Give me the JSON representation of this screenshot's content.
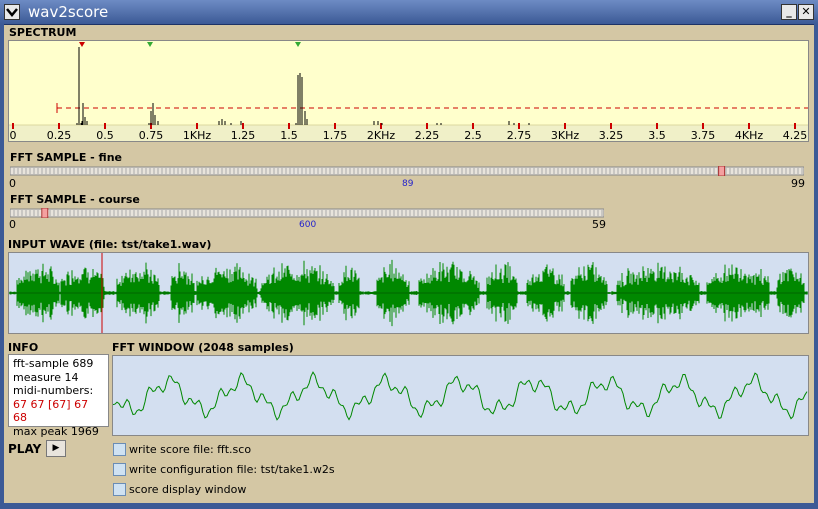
{
  "window": {
    "title": "wav2score",
    "minimize": "_",
    "maximize": "□",
    "close": "✕"
  },
  "spectrum": {
    "label": "SPECTRUM",
    "axis_labels": [
      "0",
      "0.25",
      "0.5",
      "0.75",
      "1KHz",
      "1.25",
      "1.5",
      "1.75",
      "2KHz",
      "2.25",
      "2.5",
      "2.75",
      "3KHz",
      "3.25",
      "3.5",
      "3.75",
      "4KHz",
      "4.25"
    ],
    "colors": {
      "background": "#ffffcc",
      "threshold": "#cc0000",
      "marker_red": "#cc0000",
      "marker_green": "#33aa33"
    }
  },
  "fft_fine": {
    "label": "FFT SAMPLE - fine",
    "min": "0",
    "max": "99",
    "value": "89",
    "value_num": 89,
    "range_max": 99
  },
  "fft_course": {
    "label": "FFT SAMPLE - course",
    "min": "0",
    "max": "59",
    "value": "600",
    "value_num": 3,
    "range_max": 59
  },
  "input_wave": {
    "label": "INPUT WAVE (file: tst/take1.wav)",
    "colors": {
      "wave": "#008800",
      "cursor": "#cc0000",
      "background": "#d3dff0"
    }
  },
  "info": {
    "label": "INFO",
    "lines": [
      "fft-sample 689",
      "measure 14",
      "midi-numbers:"
    ],
    "midi": "67 67 [67] 67 68",
    "peak": "max peak 1969"
  },
  "fft_window": {
    "label": "FFT WINDOW (2048 samples)"
  },
  "play": {
    "label": "PLAY",
    "button": "▶"
  },
  "options": [
    {
      "label": "write score file: fft.sco",
      "checked": false
    },
    {
      "label": "write configuration file: tst/take1.w2s",
      "checked": false
    },
    {
      "label": "score display window",
      "checked": false
    }
  ]
}
